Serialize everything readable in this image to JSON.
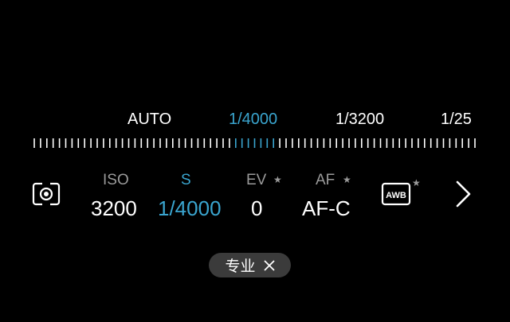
{
  "scale": {
    "labels": [
      "AUTO",
      "1/4000",
      "1/3200",
      "1/25"
    ],
    "active_index": 1
  },
  "params": {
    "iso": {
      "label": "ISO",
      "value": "3200"
    },
    "s": {
      "label": "S",
      "value": "1/4000"
    },
    "ev": {
      "label": "EV",
      "value": "0",
      "star": "★"
    },
    "af": {
      "label": "AF",
      "value": "AF-C",
      "star": "★"
    },
    "awb": {
      "label": "AWB",
      "star": "★"
    }
  },
  "mode_chip": {
    "label": "专业"
  },
  "colors": {
    "accent": "#3aa5cf",
    "muted": "#9a9a9a",
    "background": "#000000",
    "chip": "#3b3b3b"
  },
  "icons": [
    "camera-mode-icon",
    "awb-icon",
    "chevron-right-icon",
    "close-icon"
  ]
}
